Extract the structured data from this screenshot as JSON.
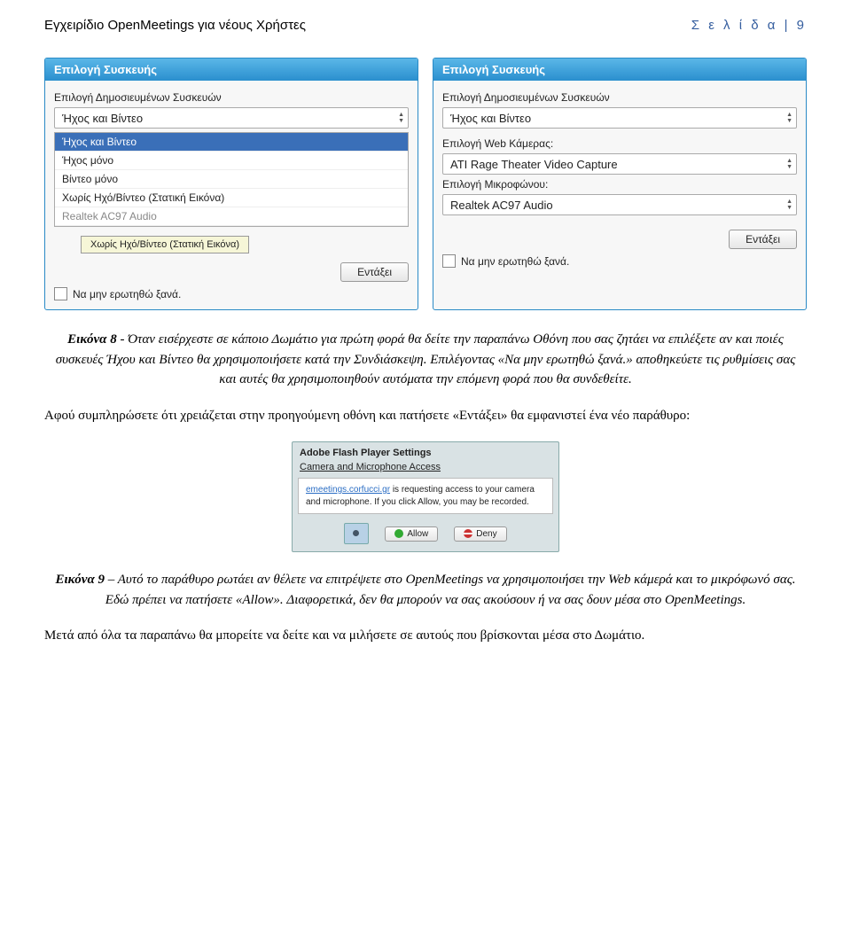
{
  "header": {
    "left": "Εγχειρίδιο OpenMeetings για νέους Χρήστες",
    "right": "Σ ε λ ί δ α  | 9"
  },
  "dlgL": {
    "title": "Επιλογή Συσκευής",
    "section1": "Επιλογή Δημοσιευμένων Συσκευών",
    "selectVal": "Ήχος και Βίντεο",
    "opt1": "Ήχος και Βίντεο",
    "opt2": "Ήχος μόνο",
    "opt3": "Βίντεο μόνο",
    "opt4": "Χωρίς Ηχό/Βίντεο (Στατική Εικόνα)",
    "dim": "Realtek AC97 Audio",
    "tooltip": "Χωρίς Ηχό/Βίντεο (Στατική Εικόνα)",
    "ok": "Εντάξει",
    "chk": "Να μην ερωτηθώ ξανά."
  },
  "dlgR": {
    "title": "Επιλογή Συσκευής",
    "section1": "Επιλογή Δημοσιευμένων Συσκευών",
    "selectVal": "Ήχος και Βίντεο",
    "camLabel": "Επιλογή Web Κάμερας:",
    "camVal": "ATI Rage Theater Video Capture",
    "micLabel": "Επιλογή Μικροφώνου:",
    "micVal": "Realtek AC97 Audio",
    "ok": "Εντάξει",
    "chk": "Να μην ερωτηθώ ξανά."
  },
  "caption8": {
    "lead": "Εικόνα 8",
    "rest": " - Όταν εισέρχεστε σε κάποιο Δωμάτιο για πρώτη φορά θα δείτε την παραπάνω Οθόνη που σας ζητάει να επιλέξετε αν και ποιές συσκευές Ήχου και Βίντεο θα χρησιμοποιήσετε κατά την Συνδιάσκεψη. Επιλέγοντας «Να μην ερωτηθώ ξανά.» αποθηκεύετε τις ρυθμίσεις σας και αυτές θα χρησιμοποιηθούν αυτόματα την επόμενη φορά που θα συνδεθείτε."
  },
  "para1": "Αφού συμπληρώσετε ότι χρειάζεται στην προηγούμενη οθόνη και πατήσετε «Εντάξει» θα εμφανιστεί ένα νέο παράθυρο:",
  "flash": {
    "title": "Adobe Flash Player Settings",
    "sub": "Camera and Microphone Access",
    "link": "emeetings.corfucci.gr",
    "msg": " is requesting access to your camera and microphone. If you click Allow, you may be recorded.",
    "allow": "Allow",
    "deny": "Deny"
  },
  "caption9": {
    "lead": "Εικόνα 9",
    "rest": " – Αυτό το παράθυρο ρωτάει αν θέλετε να επιτρέψετε στο OpenMeetings να χρησιμοποιήσει την Web κάμερά και το μικρόφωνό σας. Εδώ πρέπει να πατήσετε «Allow». Διαφορετικά, δεν θα μπορούν να σας ακούσουν ή να σας δουν μέσα στο OpenMeetings."
  },
  "para2": "Μετά από όλα τα παραπάνω θα μπορείτε να δείτε και να μιλήσετε σε αυτούς που βρίσκονται μέσα στο Δωμάτιο."
}
